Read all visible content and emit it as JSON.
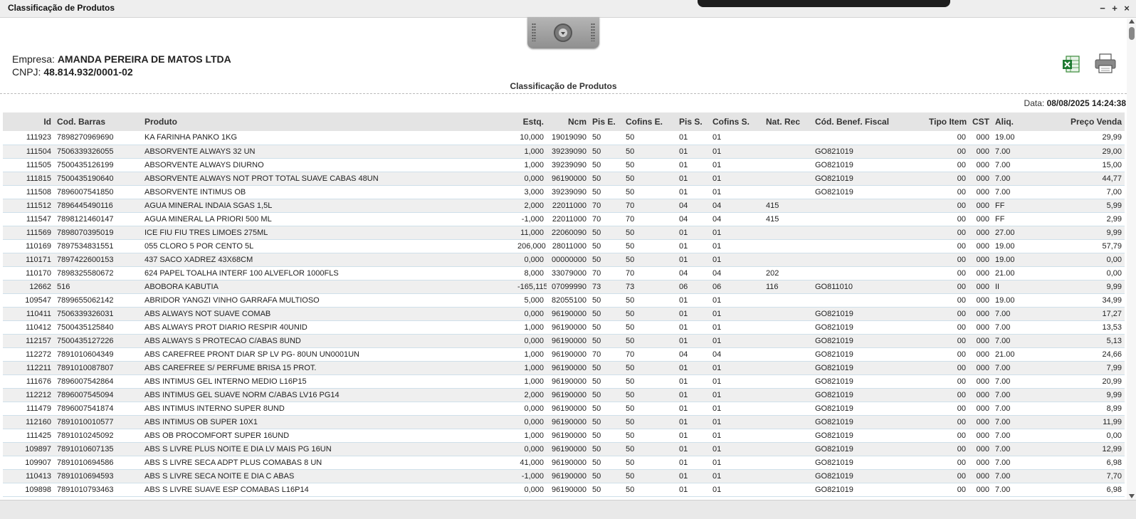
{
  "window": {
    "title": "Classificação de Produtos",
    "minimize": "−",
    "maximize": "+",
    "close": "×"
  },
  "company": {
    "empresa_label": "Empresa:",
    "empresa_value": "AMANDA PEREIRA DE MATOS LTDA",
    "cnpj_label": "CNPJ:",
    "cnpj_value": "48.814.932/0001-02"
  },
  "report": {
    "title": "Classificação de Produtos",
    "date_label": "Data:",
    "date_value": "08/08/2025 14:24:38"
  },
  "icons": {
    "excel": "excel-export-icon",
    "print": "printer-icon",
    "handle": "collapse-handle-icon"
  },
  "table": {
    "headers": [
      "Id",
      "Cod. Barras",
      "Produto",
      "Estq.",
      "Ncm",
      "Pis E.",
      "Cofins E.",
      "Pis S.",
      "Cofins S.",
      "Nat. Rec",
      "Cód. Benef. Fiscal",
      "Tipo Item",
      "CST",
      "Aliq.",
      "Preço Venda"
    ],
    "rows": [
      [
        "111923",
        "7898270969690",
        "KA FARINHA PANKO 1KG",
        "10,000",
        "19019090",
        "50",
        "50",
        "01",
        "01",
        "",
        "",
        "00",
        "000",
        "19.00",
        "29,99"
      ],
      [
        "111504",
        "7506339326055",
        "ABSORVENTE ALWAYS 32 UN",
        "1,000",
        "39239090",
        "50",
        "50",
        "01",
        "01",
        "",
        "GO821019",
        "00",
        "000",
        "7.00",
        "29,00"
      ],
      [
        "111505",
        "7500435126199",
        "ABSORVENTE ALWAYS DIURNO",
        "1,000",
        "39239090",
        "50",
        "50",
        "01",
        "01",
        "",
        "GO821019",
        "00",
        "000",
        "7.00",
        "15,00"
      ],
      [
        "111815",
        "7500435190640",
        "ABSORVENTE ALWAYS NOT PROT TOTAL SUAVE CABAS 48UN",
        "0,000",
        "96190000",
        "50",
        "50",
        "01",
        "01",
        "",
        "GO821019",
        "00",
        "000",
        "7.00",
        "44,77"
      ],
      [
        "111508",
        "7896007541850",
        "ABSORVENTE INTIMUS OB",
        "3,000",
        "39239090",
        "50",
        "50",
        "01",
        "01",
        "",
        "GO821019",
        "00",
        "000",
        "7.00",
        "7,00"
      ],
      [
        "111512",
        "7896445490116",
        "AGUA MINERAL INDAIA SGAS 1,5L",
        "2,000",
        "22011000",
        "70",
        "70",
        "04",
        "04",
        "415",
        "",
        "00",
        "000",
        "FF",
        "5,99"
      ],
      [
        "111547",
        "7898121460147",
        "AGUA MINERAL LA PRIORI 500 ML",
        "-1,000",
        "22011000",
        "70",
        "70",
        "04",
        "04",
        "415",
        "",
        "00",
        "000",
        "FF",
        "2,99"
      ],
      [
        "111569",
        "7898070395019",
        "ICE FIU FIU TRES LIMOES 275ML",
        "11,000",
        "22060090",
        "50",
        "50",
        "01",
        "01",
        "",
        "",
        "00",
        "000",
        "27.00",
        "9,99"
      ],
      [
        "110169",
        "7897534831551",
        "055 CLORO 5 POR CENTO 5L",
        "206,000",
        "28011000",
        "50",
        "50",
        "01",
        "01",
        "",
        "",
        "00",
        "000",
        "19.00",
        "57,79"
      ],
      [
        "110171",
        "7897422600153",
        "437 SACO XADREZ 43X68CM",
        "0,000",
        "00000000",
        "50",
        "50",
        "01",
        "01",
        "",
        "",
        "00",
        "000",
        "19.00",
        "0,00"
      ],
      [
        "110170",
        "7898325580672",
        "624 PAPEL TOALHA INTERF 100 ALVEFLOR 1000FLS",
        "8,000",
        "33079000",
        "70",
        "70",
        "04",
        "04",
        "202",
        "",
        "00",
        "000",
        "21.00",
        "0,00"
      ],
      [
        "12662",
        "516",
        "ABOBORA KABUTIA",
        "-165,115",
        "07099990",
        "73",
        "73",
        "06",
        "06",
        "116",
        "GO811010",
        "00",
        "000",
        "II",
        "9,99"
      ],
      [
        "109547",
        "7899655062142",
        "ABRIDOR YANGZI VINHO GARRAFA MULTIOSO",
        "5,000",
        "82055100",
        "50",
        "50",
        "01",
        "01",
        "",
        "",
        "00",
        "000",
        "19.00",
        "34,99"
      ],
      [
        "110411",
        "7506339326031",
        "ABS ALWAYS NOT SUAVE COMAB",
        "0,000",
        "96190000",
        "50",
        "50",
        "01",
        "01",
        "",
        "GO821019",
        "00",
        "000",
        "7.00",
        "17,27"
      ],
      [
        "110412",
        "7500435125840",
        "ABS ALWAYS PROT DIARIO RESPIR 40UNID",
        "1,000",
        "96190000",
        "50",
        "50",
        "01",
        "01",
        "",
        "GO821019",
        "00",
        "000",
        "7.00",
        "13,53"
      ],
      [
        "112157",
        "7500435127226",
        "ABS ALWAYS S PROTECAO C/ABAS 8UND",
        "0,000",
        "96190000",
        "50",
        "50",
        "01",
        "01",
        "",
        "GO821019",
        "00",
        "000",
        "7.00",
        "5,13"
      ],
      [
        "112272",
        "7891010604349",
        "ABS CAREFREE PRONT DIAR SP LV PG- 80UN UN0001UN",
        "1,000",
        "96190000",
        "70",
        "70",
        "04",
        "04",
        "",
        "GO821019",
        "00",
        "000",
        "21.00",
        "24,66"
      ],
      [
        "112211",
        "7891010087807",
        "ABS CAREFREE S/ PERFUME BRISA 15 PROT.",
        "1,000",
        "96190000",
        "50",
        "50",
        "01",
        "01",
        "",
        "GO821019",
        "00",
        "000",
        "7.00",
        "7,99"
      ],
      [
        "111676",
        "7896007542864",
        "ABS INTIMUS GEL INTERNO MEDIO L16P15",
        "1,000",
        "96190000",
        "50",
        "50",
        "01",
        "01",
        "",
        "GO821019",
        "00",
        "000",
        "7.00",
        "20,99"
      ],
      [
        "112212",
        "7896007545094",
        "ABS INTIMUS GEL SUAVE NORM C/ABAS LV16 PG14",
        "2,000",
        "96190000",
        "50",
        "50",
        "01",
        "01",
        "",
        "GO821019",
        "00",
        "000",
        "7.00",
        "9,99"
      ],
      [
        "111479",
        "7896007541874",
        "ABS INTIMUS INTERNO SUPER 8UND",
        "0,000",
        "96190000",
        "50",
        "50",
        "01",
        "01",
        "",
        "GO821019",
        "00",
        "000",
        "7.00",
        "8,99"
      ],
      [
        "112160",
        "7891010010577",
        "ABS INTIMUS OB SUPER 10X1",
        "0,000",
        "96190000",
        "50",
        "50",
        "01",
        "01",
        "",
        "GO821019",
        "00",
        "000",
        "7.00",
        "11,99"
      ],
      [
        "111425",
        "7891010245092",
        "ABS OB PROCOMFORT SUPER 16UND",
        "1,000",
        "96190000",
        "50",
        "50",
        "01",
        "01",
        "",
        "GO821019",
        "00",
        "000",
        "7.00",
        "0,00"
      ],
      [
        "109897",
        "7891010607135",
        "ABS S LIVRE PLUS NOITE E DIA LV MAIS PG 16UN",
        "0,000",
        "96190000",
        "50",
        "50",
        "01",
        "01",
        "",
        "GO821019",
        "00",
        "000",
        "7.00",
        "12,99"
      ],
      [
        "109907",
        "7891010694586",
        "ABS S LIVRE SECA ADPT PLUS COMABAS 8 UN",
        "41,000",
        "96190000",
        "50",
        "50",
        "01",
        "01",
        "",
        "GO821019",
        "00",
        "000",
        "7.00",
        "6,98"
      ],
      [
        "110413",
        "7891010694593",
        "ABS S LIVRE SECA NOITE E DIA C ABAS",
        "-1,000",
        "96190000",
        "50",
        "50",
        "01",
        "01",
        "",
        "GO821019",
        "00",
        "000",
        "7.00",
        "7,70"
      ],
      [
        "109898",
        "7891010793463",
        "ABS S LIVRE SUAVE ESP COMABAS L16P14",
        "0,000",
        "96190000",
        "50",
        "50",
        "01",
        "01",
        "",
        "GO821019",
        "00",
        "000",
        "7.00",
        "6,98"
      ]
    ]
  }
}
